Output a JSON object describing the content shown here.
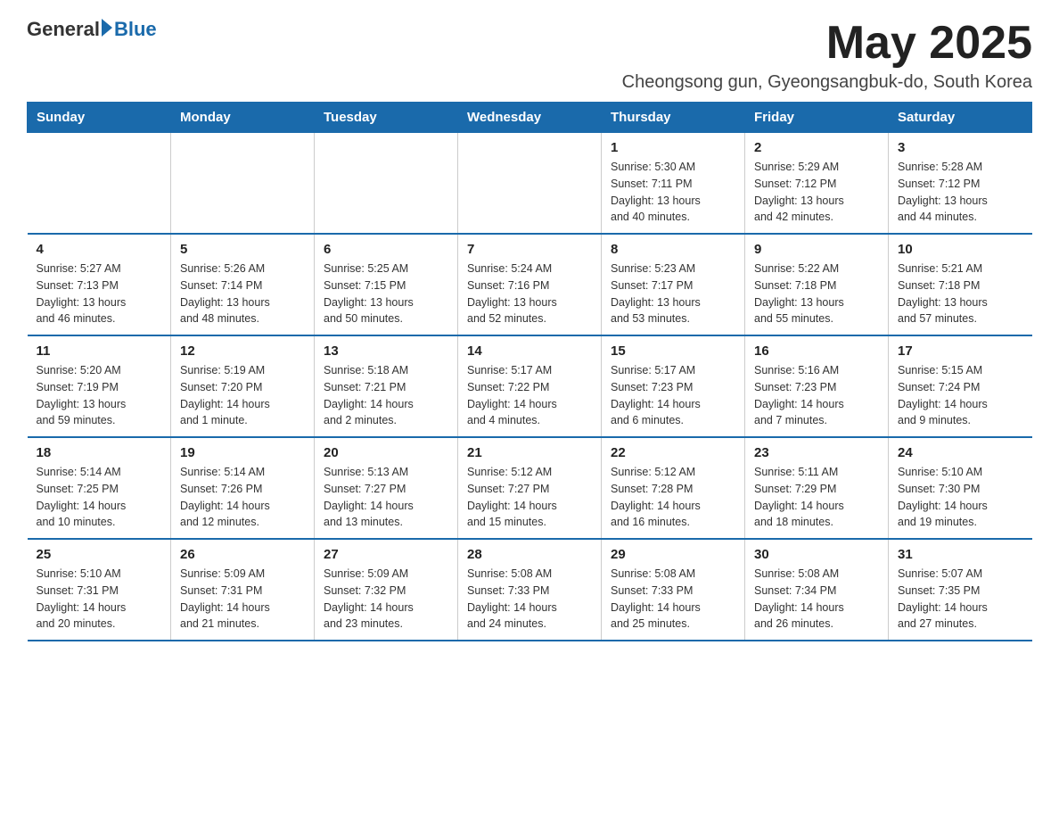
{
  "logo": {
    "general": "General",
    "blue": "Blue"
  },
  "header": {
    "month": "May 2025",
    "location": "Cheongsong gun, Gyeongsangbuk-do, South Korea"
  },
  "days_of_week": [
    "Sunday",
    "Monday",
    "Tuesday",
    "Wednesday",
    "Thursday",
    "Friday",
    "Saturday"
  ],
  "weeks": [
    [
      {
        "day": "",
        "info": ""
      },
      {
        "day": "",
        "info": ""
      },
      {
        "day": "",
        "info": ""
      },
      {
        "day": "",
        "info": ""
      },
      {
        "day": "1",
        "info": "Sunrise: 5:30 AM\nSunset: 7:11 PM\nDaylight: 13 hours\nand 40 minutes."
      },
      {
        "day": "2",
        "info": "Sunrise: 5:29 AM\nSunset: 7:12 PM\nDaylight: 13 hours\nand 42 minutes."
      },
      {
        "day": "3",
        "info": "Sunrise: 5:28 AM\nSunset: 7:12 PM\nDaylight: 13 hours\nand 44 minutes."
      }
    ],
    [
      {
        "day": "4",
        "info": "Sunrise: 5:27 AM\nSunset: 7:13 PM\nDaylight: 13 hours\nand 46 minutes."
      },
      {
        "day": "5",
        "info": "Sunrise: 5:26 AM\nSunset: 7:14 PM\nDaylight: 13 hours\nand 48 minutes."
      },
      {
        "day": "6",
        "info": "Sunrise: 5:25 AM\nSunset: 7:15 PM\nDaylight: 13 hours\nand 50 minutes."
      },
      {
        "day": "7",
        "info": "Sunrise: 5:24 AM\nSunset: 7:16 PM\nDaylight: 13 hours\nand 52 minutes."
      },
      {
        "day": "8",
        "info": "Sunrise: 5:23 AM\nSunset: 7:17 PM\nDaylight: 13 hours\nand 53 minutes."
      },
      {
        "day": "9",
        "info": "Sunrise: 5:22 AM\nSunset: 7:18 PM\nDaylight: 13 hours\nand 55 minutes."
      },
      {
        "day": "10",
        "info": "Sunrise: 5:21 AM\nSunset: 7:18 PM\nDaylight: 13 hours\nand 57 minutes."
      }
    ],
    [
      {
        "day": "11",
        "info": "Sunrise: 5:20 AM\nSunset: 7:19 PM\nDaylight: 13 hours\nand 59 minutes."
      },
      {
        "day": "12",
        "info": "Sunrise: 5:19 AM\nSunset: 7:20 PM\nDaylight: 14 hours\nand 1 minute."
      },
      {
        "day": "13",
        "info": "Sunrise: 5:18 AM\nSunset: 7:21 PM\nDaylight: 14 hours\nand 2 minutes."
      },
      {
        "day": "14",
        "info": "Sunrise: 5:17 AM\nSunset: 7:22 PM\nDaylight: 14 hours\nand 4 minutes."
      },
      {
        "day": "15",
        "info": "Sunrise: 5:17 AM\nSunset: 7:23 PM\nDaylight: 14 hours\nand 6 minutes."
      },
      {
        "day": "16",
        "info": "Sunrise: 5:16 AM\nSunset: 7:23 PM\nDaylight: 14 hours\nand 7 minutes."
      },
      {
        "day": "17",
        "info": "Sunrise: 5:15 AM\nSunset: 7:24 PM\nDaylight: 14 hours\nand 9 minutes."
      }
    ],
    [
      {
        "day": "18",
        "info": "Sunrise: 5:14 AM\nSunset: 7:25 PM\nDaylight: 14 hours\nand 10 minutes."
      },
      {
        "day": "19",
        "info": "Sunrise: 5:14 AM\nSunset: 7:26 PM\nDaylight: 14 hours\nand 12 minutes."
      },
      {
        "day": "20",
        "info": "Sunrise: 5:13 AM\nSunset: 7:27 PM\nDaylight: 14 hours\nand 13 minutes."
      },
      {
        "day": "21",
        "info": "Sunrise: 5:12 AM\nSunset: 7:27 PM\nDaylight: 14 hours\nand 15 minutes."
      },
      {
        "day": "22",
        "info": "Sunrise: 5:12 AM\nSunset: 7:28 PM\nDaylight: 14 hours\nand 16 minutes."
      },
      {
        "day": "23",
        "info": "Sunrise: 5:11 AM\nSunset: 7:29 PM\nDaylight: 14 hours\nand 18 minutes."
      },
      {
        "day": "24",
        "info": "Sunrise: 5:10 AM\nSunset: 7:30 PM\nDaylight: 14 hours\nand 19 minutes."
      }
    ],
    [
      {
        "day": "25",
        "info": "Sunrise: 5:10 AM\nSunset: 7:31 PM\nDaylight: 14 hours\nand 20 minutes."
      },
      {
        "day": "26",
        "info": "Sunrise: 5:09 AM\nSunset: 7:31 PM\nDaylight: 14 hours\nand 21 minutes."
      },
      {
        "day": "27",
        "info": "Sunrise: 5:09 AM\nSunset: 7:32 PM\nDaylight: 14 hours\nand 23 minutes."
      },
      {
        "day": "28",
        "info": "Sunrise: 5:08 AM\nSunset: 7:33 PM\nDaylight: 14 hours\nand 24 minutes."
      },
      {
        "day": "29",
        "info": "Sunrise: 5:08 AM\nSunset: 7:33 PM\nDaylight: 14 hours\nand 25 minutes."
      },
      {
        "day": "30",
        "info": "Sunrise: 5:08 AM\nSunset: 7:34 PM\nDaylight: 14 hours\nand 26 minutes."
      },
      {
        "day": "31",
        "info": "Sunrise: 5:07 AM\nSunset: 7:35 PM\nDaylight: 14 hours\nand 27 minutes."
      }
    ]
  ]
}
